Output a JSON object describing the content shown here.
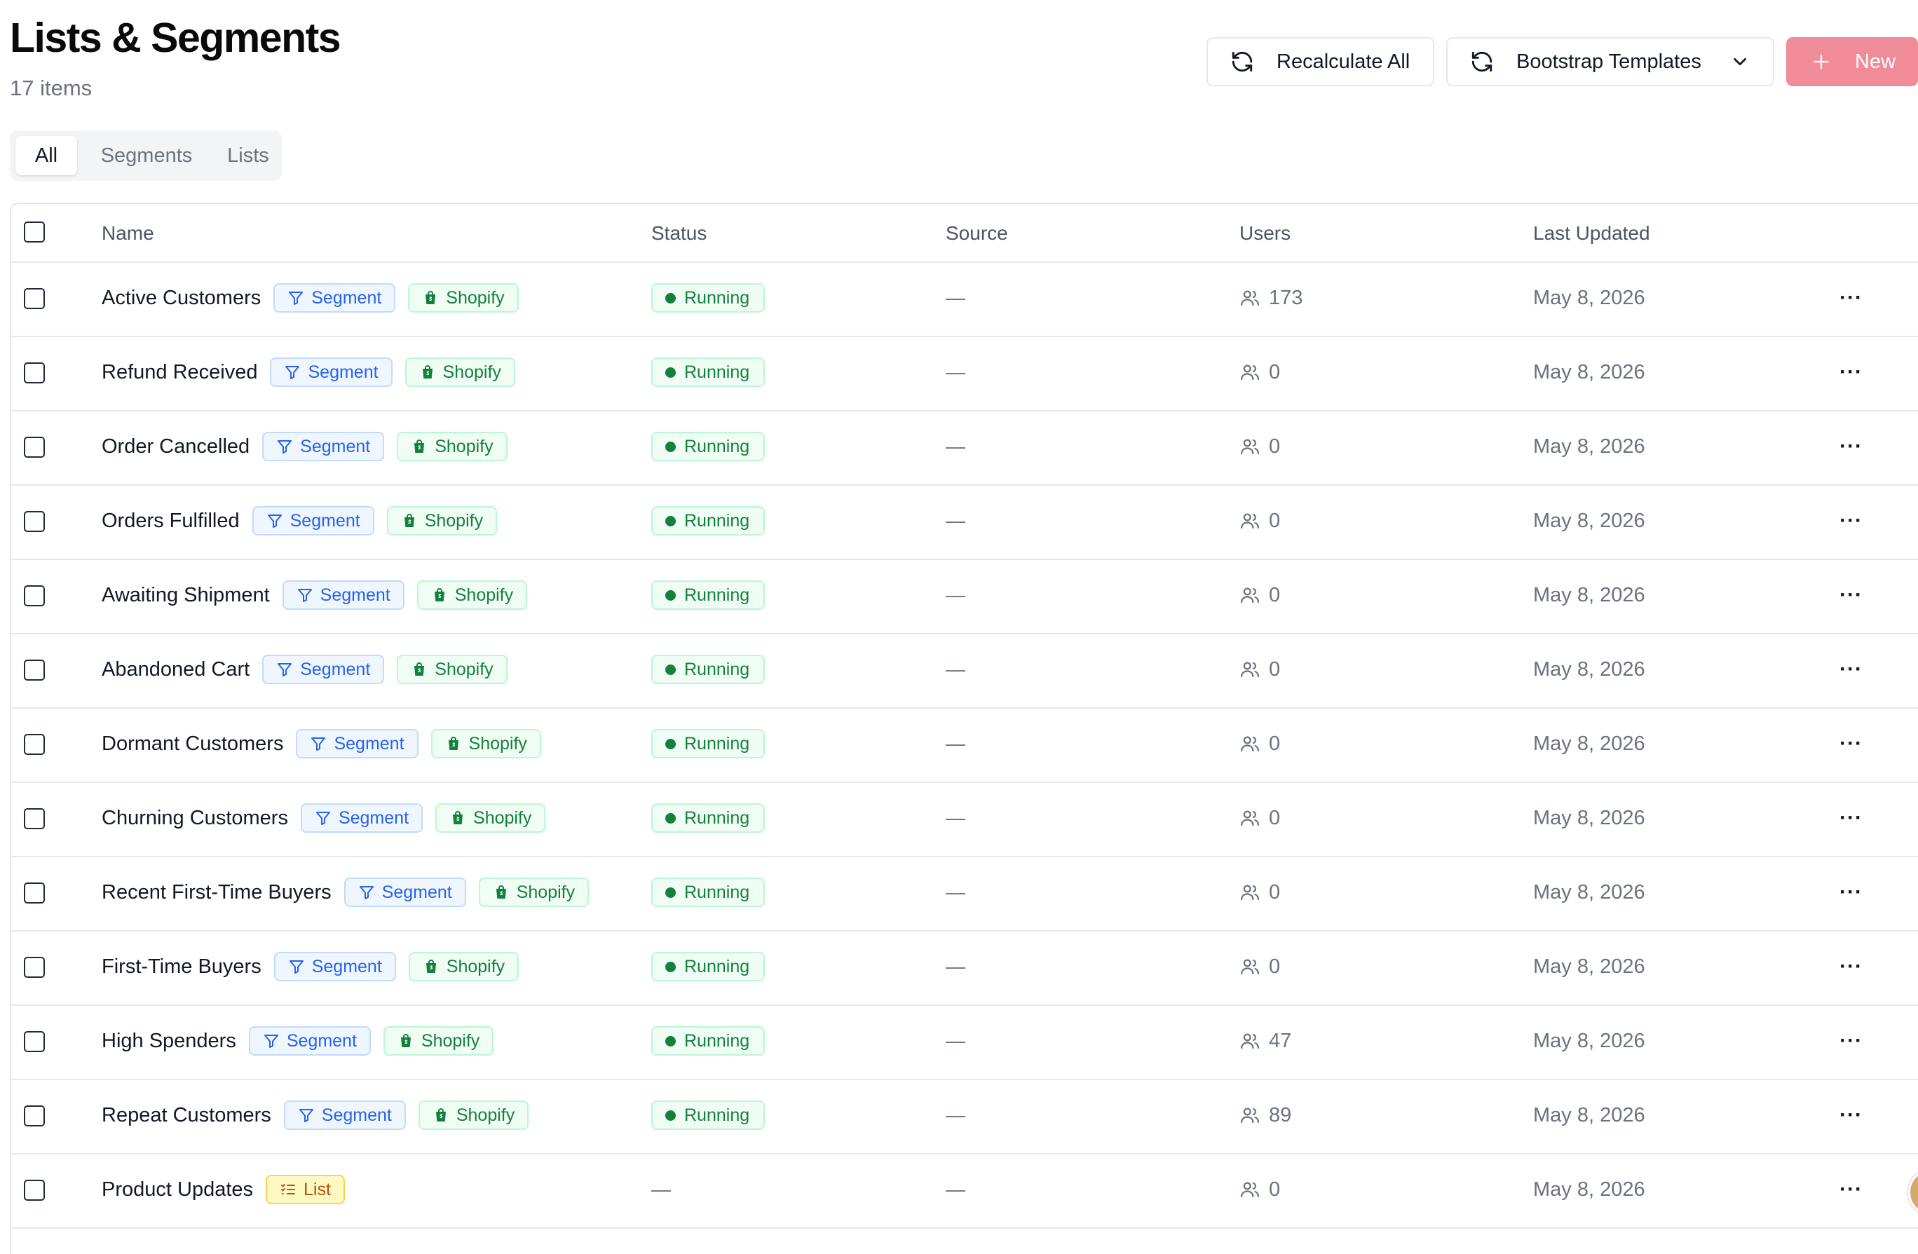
{
  "header": {
    "title": "Lists & Segments",
    "count": "17 items"
  },
  "actions": {
    "recalculate_label": "Recalculate All",
    "templates_label": "Bootstrap Templates",
    "new_label": "New",
    "new_color": "#f08b98"
  },
  "tabs": [
    {
      "label": "All",
      "active": true
    },
    {
      "label": "Segments",
      "active": false
    },
    {
      "label": "Lists",
      "active": false
    }
  ],
  "table": {
    "columns": [
      "Name",
      "Status",
      "Source",
      "Users",
      "Last Updated"
    ],
    "rows": [
      {
        "name": "Active Customers",
        "type": "Segment",
        "integration": "Shopify",
        "status": "Running",
        "source": "—",
        "users": "173",
        "updated": "May 8, 2026"
      },
      {
        "name": "Refund Received",
        "type": "Segment",
        "integration": "Shopify",
        "status": "Running",
        "source": "—",
        "users": "0",
        "updated": "May 8, 2026"
      },
      {
        "name": "Order Cancelled",
        "type": "Segment",
        "integration": "Shopify",
        "status": "Running",
        "source": "—",
        "users": "0",
        "updated": "May 8, 2026"
      },
      {
        "name": "Orders Fulfilled",
        "type": "Segment",
        "integration": "Shopify",
        "status": "Running",
        "source": "—",
        "users": "0",
        "updated": "May 8, 2026"
      },
      {
        "name": "Awaiting Shipment",
        "type": "Segment",
        "integration": "Shopify",
        "status": "Running",
        "source": "—",
        "users": "0",
        "updated": "May 8, 2026"
      },
      {
        "name": "Abandoned Cart",
        "type": "Segment",
        "integration": "Shopify",
        "status": "Running",
        "source": "—",
        "users": "0",
        "updated": "May 8, 2026"
      },
      {
        "name": "Dormant Customers",
        "type": "Segment",
        "integration": "Shopify",
        "status": "Running",
        "source": "—",
        "users": "0",
        "updated": "May 8, 2026"
      },
      {
        "name": "Churning Customers",
        "type": "Segment",
        "integration": "Shopify",
        "status": "Running",
        "source": "—",
        "users": "0",
        "updated": "May 8, 2026"
      },
      {
        "name": "Recent First-Time Buyers",
        "type": "Segment",
        "integration": "Shopify",
        "status": "Running",
        "source": "—",
        "users": "0",
        "updated": "May 8, 2026"
      },
      {
        "name": "First-Time Buyers",
        "type": "Segment",
        "integration": "Shopify",
        "status": "Running",
        "source": "—",
        "users": "0",
        "updated": "May 8, 2026"
      },
      {
        "name": "High Spenders",
        "type": "Segment",
        "integration": "Shopify",
        "status": "Running",
        "source": "—",
        "users": "47",
        "updated": "May 8, 2026"
      },
      {
        "name": "Repeat Customers",
        "type": "Segment",
        "integration": "Shopify",
        "status": "Running",
        "source": "—",
        "users": "89",
        "updated": "May 8, 2026"
      },
      {
        "name": "Product Updates",
        "type": "List",
        "integration": "",
        "status": "—",
        "source": "—",
        "users": "0",
        "updated": "May 8, 2026"
      }
    ]
  },
  "icons": {
    "recalculate": "refresh-icon",
    "templates": "refresh-icon",
    "templates_dropdown": "chevron-down-icon",
    "new": "plus-icon",
    "segment": "filter-icon",
    "shopify": "shopify-bag-icon",
    "list": "list-checks-icon",
    "users": "users-icon",
    "row_menu": "more-horizontal-icon"
  },
  "colors": {
    "segment_badge": "#2563eb",
    "shopify_badge": "#15803d",
    "list_badge": "#b45309",
    "running": "#15803d"
  }
}
